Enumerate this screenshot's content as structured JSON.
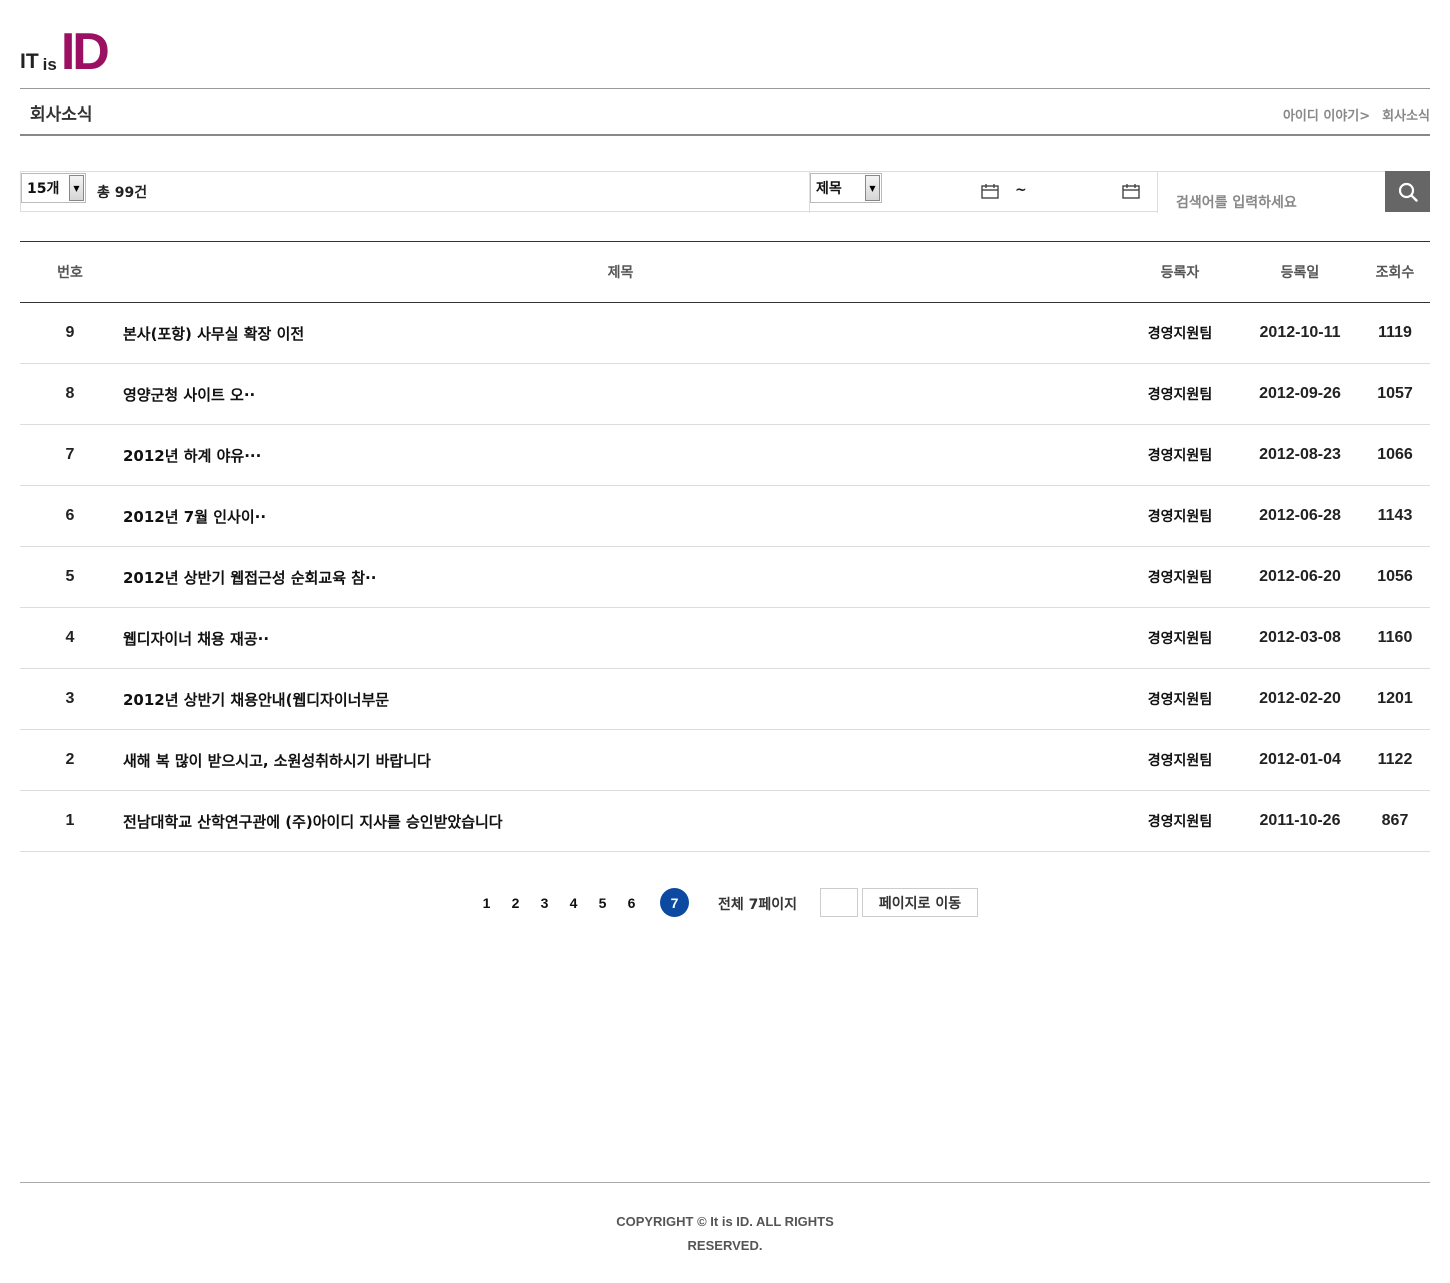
{
  "logo": {
    "text_it": "IT",
    "text_is": "is",
    "text_id": "ID",
    "id_color": "#9b1062"
  },
  "header": {
    "page_title": "회사소식",
    "breadcrumb": [
      "아이디 이야기>",
      "회사소식"
    ]
  },
  "toolbar": {
    "page_size_selected": "15개",
    "total_count": "총 99건",
    "field_selected": "제목",
    "date_separator": "~",
    "search_placeholder": "검색어를 입력하세요"
  },
  "table": {
    "headers": {
      "no": "번호",
      "title": "제목",
      "author": "등록자",
      "date": "등록일",
      "views": "조회수"
    },
    "rows": [
      {
        "no": "9",
        "title": "본사(포항) 사무실 확장 이전",
        "author": "경영지원팀",
        "date": "2012-10-11",
        "views": "1119"
      },
      {
        "no": "8",
        "title": "영양군청 사이트 오··",
        "author": "경영지원팀",
        "date": "2012-09-26",
        "views": "1057"
      },
      {
        "no": "7",
        "title": "2012년 하계 야유···",
        "author": "경영지원팀",
        "date": "2012-08-23",
        "views": "1066"
      },
      {
        "no": "6",
        "title": "2012년 7월 인사이··",
        "author": "경영지원팀",
        "date": "2012-06-28",
        "views": "1143"
      },
      {
        "no": "5",
        "title": "2012년 상반기 웹접근성 순회교육 참··",
        "author": "경영지원팀",
        "date": "2012-06-20",
        "views": "1056"
      },
      {
        "no": "4",
        "title": "웹디자이너 채용 재공··",
        "author": "경영지원팀",
        "date": "2012-03-08",
        "views": "1160"
      },
      {
        "no": "3",
        "title": "2012년 상반기 채용안내(웹디자이너부문",
        "author": "경영지원팀",
        "date": "2012-02-20",
        "views": "1201"
      },
      {
        "no": "2",
        "title": "새해 복 많이 받으시고, 소원성취하시기 바랍니다",
        "author": "경영지원팀",
        "date": "2012-01-04",
        "views": "1122"
      },
      {
        "no": "1",
        "title": "전남대학교 산학연구관에 (주)아이디 지사를 승인받았습니다",
        "author": "경영지원팀",
        "date": "2011-10-26",
        "views": "867"
      }
    ]
  },
  "pager": {
    "pages": [
      "1",
      "2",
      "3",
      "4",
      "5",
      "6",
      "7"
    ],
    "current": "7",
    "total_label": "전체 7페이지",
    "go_label": "페이지로 이동",
    "active_color": "#0b4aa0"
  },
  "footer": {
    "copyright_line1": "COPYRIGHT © It is ID. ALL RIGHTS",
    "copyright_line2": "RESERVED."
  }
}
